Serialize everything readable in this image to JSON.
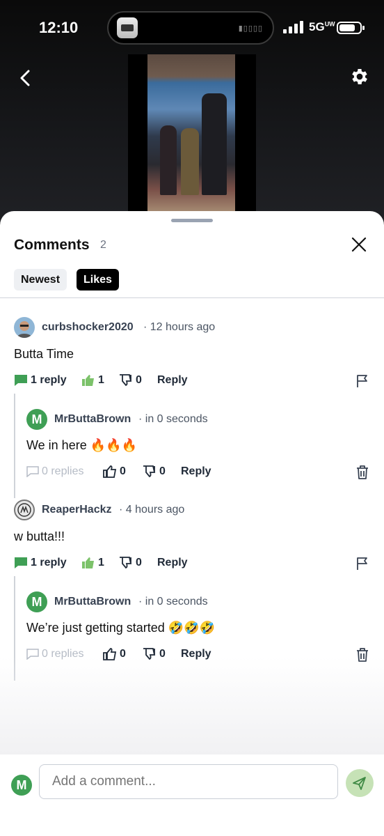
{
  "status_bar": {
    "time": "12:10",
    "network": "5G",
    "network_sup": "UW"
  },
  "sheet": {
    "title": "Comments",
    "count": "2",
    "tabs": [
      {
        "label": "Newest",
        "active": false
      },
      {
        "label": "Likes",
        "active": true
      }
    ]
  },
  "comments": [
    {
      "user": "curbshocker2020",
      "time": "· 12 hours ago",
      "body": "Butta Time",
      "replies_label": "1 reply",
      "likes": "1",
      "dislikes": "0",
      "reply_label": "Reply",
      "reply": {
        "avatar_letter": "M",
        "user": "MrButtaBrown",
        "time": "· in 0 seconds",
        "body": "We in here 🔥🔥🔥",
        "replies_label": "0 replies",
        "likes": "0",
        "dislikes": "0",
        "reply_label": "Reply"
      }
    },
    {
      "user": "ReaperHackz",
      "time": "· 4 hours ago",
      "body": "w butta!!!",
      "replies_label": "1 reply",
      "likes": "1",
      "dislikes": "0",
      "reply_label": "Reply",
      "reply": {
        "avatar_letter": "M",
        "user": "MrButtaBrown",
        "time": "· in 0 seconds",
        "body": "We’re just getting started 🤣🤣🤣",
        "replies_label": "0 replies",
        "likes": "0",
        "dislikes": "0",
        "reply_label": "Reply"
      }
    }
  ],
  "composer": {
    "avatar_letter": "M",
    "placeholder": "Add a comment..."
  },
  "colors": {
    "accent_green": "#3f9f55",
    "like_green": "#7cc26a",
    "send_bg": "#c6e2b6"
  }
}
